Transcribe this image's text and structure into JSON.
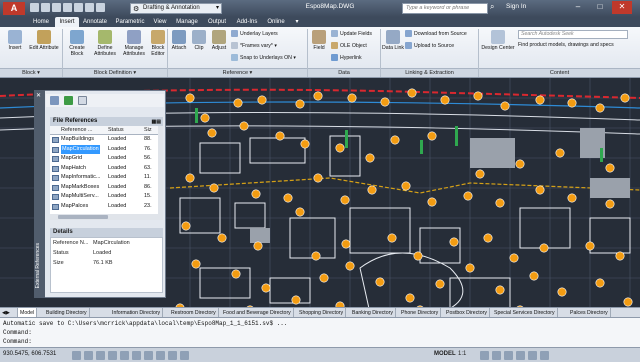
{
  "titlebar": {
    "logo": "A",
    "workspace": "Drafting & Annotation",
    "document": "Espo8Map.DWG",
    "search_placeholder": "Type a keyword or phrase",
    "signin": "Sign In",
    "min": "–",
    "max": "□",
    "close": "✕"
  },
  "tabs": [
    "Home",
    "Insert",
    "Annotate",
    "Parametric",
    "View",
    "Manage",
    "Output",
    "Add-Ins",
    "Online"
  ],
  "active_tab": "Insert",
  "ribbon": {
    "block": {
      "insert": "Insert",
      "edit_attribute": "Edit Attribute",
      "panel": "Block ▾"
    },
    "block_def": {
      "create_block": "Create Block",
      "define_attributes": "Define Attributes",
      "manage_attributes": "Manage Attributes",
      "block_editor": "Block Editor",
      "panel": "Block Definition ▾"
    },
    "reference": {
      "attach": "Attach",
      "clip": "Clip",
      "adjust": "Adjust",
      "underlay_layers": "Underlay Layers",
      "frames_vary": "*Frames vary*",
      "snap_underlays": "Snap to Underlays ON",
      "panel": "Reference ▾"
    },
    "data": {
      "field": "Field",
      "update_fields": "Update Fields",
      "ole_object": "OLE Object",
      "hyperlink": "Hyperlink",
      "panel": "Data"
    },
    "linking": {
      "data_link": "Data Link",
      "download_source": "Download from Source",
      "upload_source": "Upload to Source",
      "panel": "Linking & Extraction"
    },
    "content": {
      "design_center": "Design Center",
      "search_placeholder": "Search Autodesk Seek",
      "find_models": "Find product models, drawings and specs",
      "panel": "Content"
    }
  },
  "palette": {
    "vertical_title": "External References",
    "file_references_title": "File References",
    "columns": {
      "name": "Reference ...",
      "status": "Status",
      "size": "Siz"
    },
    "rows": [
      {
        "name": "MapBuildings",
        "status": "Loaded",
        "size": "88."
      },
      {
        "name": "MapCirculation",
        "status": "Loaded",
        "size": "76."
      },
      {
        "name": "MapGrid",
        "status": "Loaded",
        "size": "56."
      },
      {
        "name": "MapHatch",
        "status": "Loaded",
        "size": "63."
      },
      {
        "name": "MapInformatic...",
        "status": "Loaded",
        "size": "11."
      },
      {
        "name": "MapMarkBoxes",
        "status": "Loaded",
        "size": "86."
      },
      {
        "name": "MapMultiServ...",
        "status": "Loaded",
        "size": "15."
      },
      {
        "name": "MapPalces",
        "status": "Loaded",
        "size": "23."
      }
    ],
    "selected_index": 1,
    "details_title": "Details",
    "details": [
      {
        "k": "Reference N...",
        "v": "MapCirculation"
      },
      {
        "k": "Status",
        "v": "Loaded"
      },
      {
        "k": "Size",
        "v": "76.1 KB"
      }
    ]
  },
  "layout_tabs": [
    "Model",
    "Building Directory",
    "Information Directory",
    "Restroom Directory",
    "Food and Beverage Directory",
    "Shopping Directory",
    "Banking Directory",
    "Phone Directory",
    "Postbox Directory",
    "Special Services Directory",
    "Palces Directory"
  ],
  "active_layout": "Model",
  "command": {
    "line1": "Automatic save to C:\\Users\\mcrrick\\appdata\\local\\temp\\Espo8Map_1_1_6151.sv$ ...",
    "line2": "Command:",
    "line3": "Command:"
  },
  "status": {
    "coords": "930.5475, 606.7531",
    "model": "MODEL",
    "scale": "1:1"
  },
  "colors": {
    "accent": "#f39c12",
    "selection": "#3399ff",
    "background": "#262d38"
  }
}
